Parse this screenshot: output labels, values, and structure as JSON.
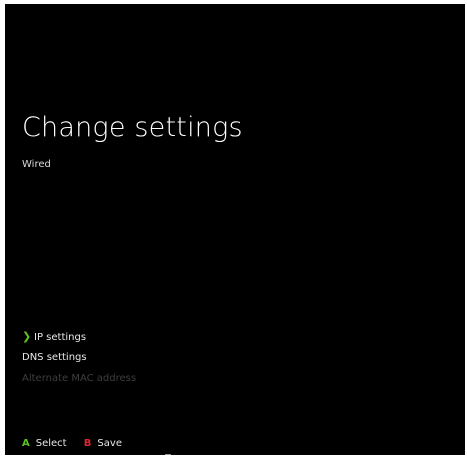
{
  "page": {
    "title": "Change settings",
    "subtitle": "Wired"
  },
  "menu": {
    "items": [
      {
        "label": "IP settings",
        "selected": true,
        "enabled": true
      },
      {
        "label": "DNS settings",
        "selected": false,
        "enabled": true
      },
      {
        "label": "Alternate MAC address",
        "selected": false,
        "enabled": false
      }
    ],
    "selected_indicator": "chevron-right-icon"
  },
  "footer": {
    "select": {
      "key": "A",
      "label": "Select",
      "color": "#5ec31f"
    },
    "save": {
      "key": "B",
      "label": "Save",
      "color": "#e0262f"
    }
  },
  "colors": {
    "background": "#000000",
    "accent": "#5ec31f",
    "text": "#ffffff"
  }
}
